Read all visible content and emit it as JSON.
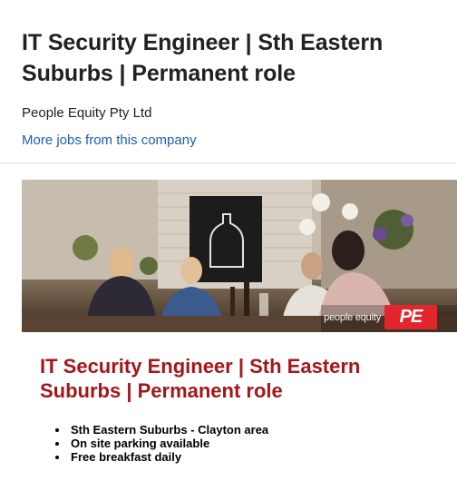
{
  "header": {
    "job_title": "IT Security Engineer | Sth Eastern Suburbs | Permanent role",
    "company": "People Equity Pty Ltd",
    "more_jobs_link": "More jobs from this company"
  },
  "banner": {
    "brand_name": "people equity",
    "logo_text": "PE",
    "colors": {
      "logo_bg": "#e1262d"
    }
  },
  "description": {
    "title": "IT Security Engineer | Sth Eastern Suburbs | Permanent role",
    "bullets": [
      "Sth Eastern Suburbs - Clayton area",
      "On site parking available",
      "Free breakfast daily"
    ],
    "colors": {
      "title": "#a4161a",
      "link": "#1a5fb4"
    }
  }
}
